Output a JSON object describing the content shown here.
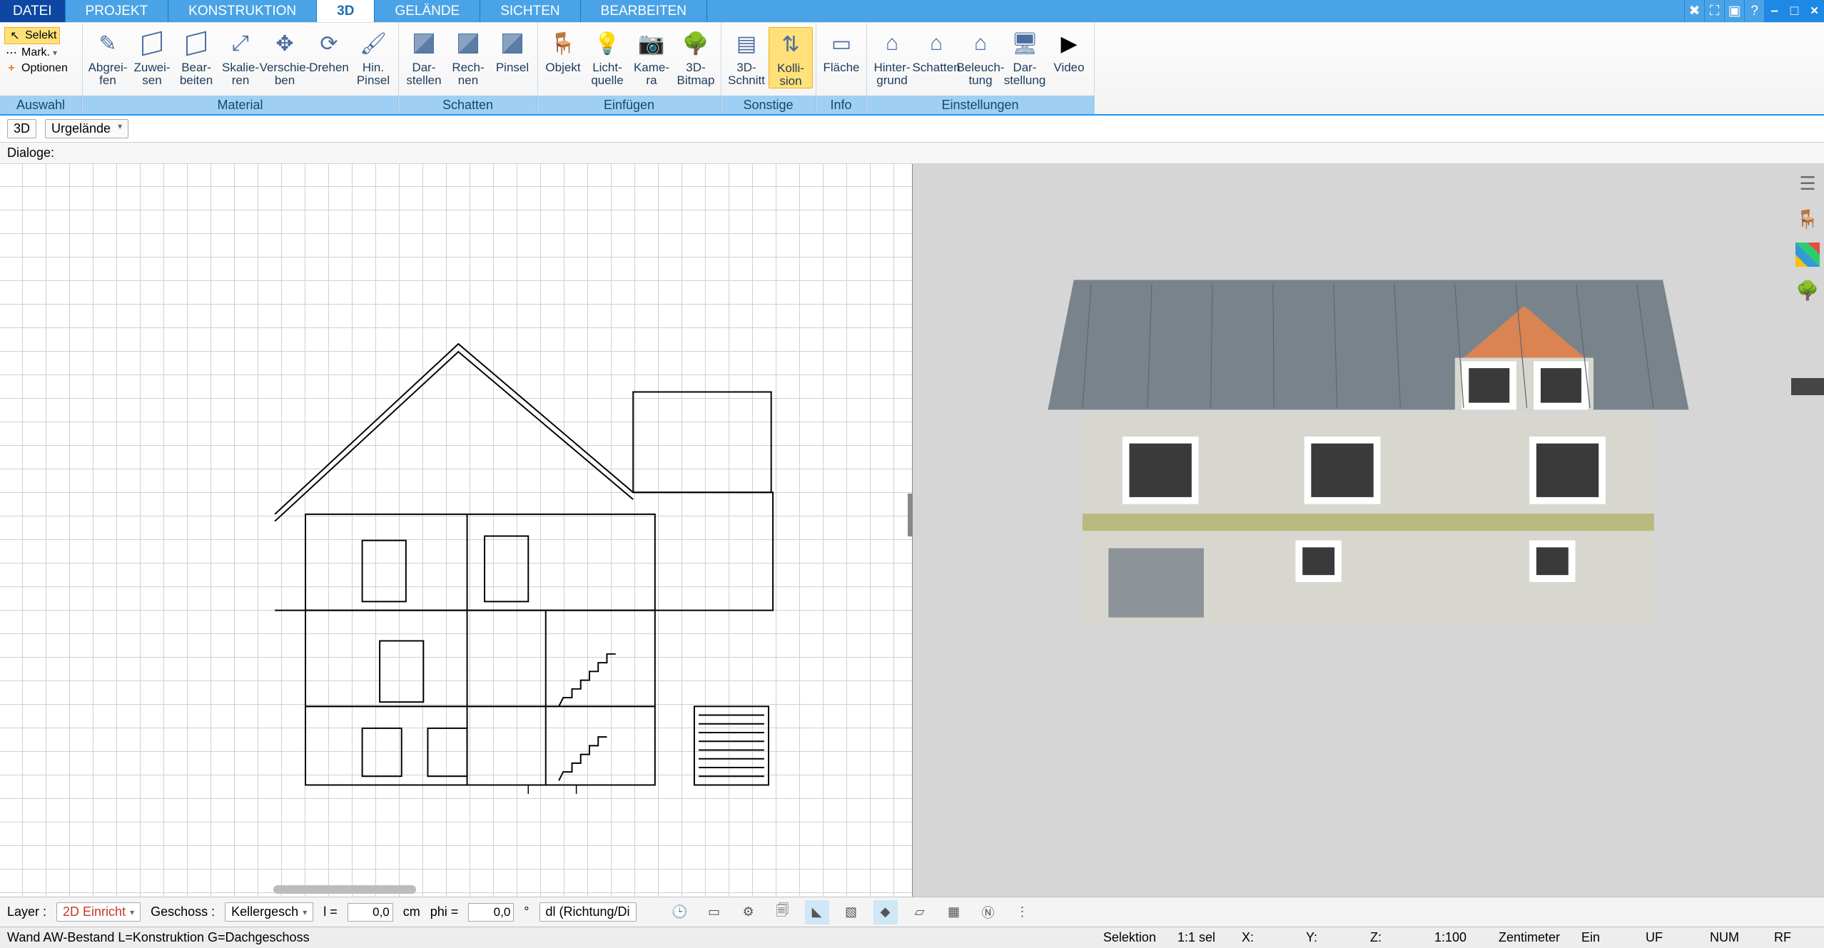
{
  "menu": {
    "tabs": [
      "DATEI",
      "PROJEKT",
      "KONSTRUKTION",
      "3D",
      "GELÄNDE",
      "SICHTEN",
      "BEARBEITEN"
    ],
    "active_index": 3,
    "right_icons": [
      "tools-icon",
      "fullscreen-icon",
      "viewport-icon",
      "help-icon",
      "minimize-icon",
      "maximize-icon",
      "close-icon"
    ]
  },
  "ribbon": {
    "auswahl": {
      "label": "Auswahl",
      "items": [
        "Selekt",
        "Mark.",
        "Optionen"
      ]
    },
    "material": {
      "label": "Material",
      "items": [
        {
          "l": "Abgrei-\nfen",
          "i": "eyedropper-icon"
        },
        {
          "l": "Zuwei-\nsen",
          "i": "assign-icon"
        },
        {
          "l": "Bear-\nbeiten",
          "i": "edit-material-icon"
        },
        {
          "l": "Skalie-\nren",
          "i": "scale-icon"
        },
        {
          "l": "Verschie-\nben",
          "i": "move-material-icon"
        },
        {
          "l": "Drehen",
          "i": "rotate-material-icon"
        },
        {
          "l": "Hin.\nPinsel",
          "i": "brush-add-icon"
        }
      ]
    },
    "schatten": {
      "label": "Schatten",
      "items": [
        {
          "l": "Dar-\nstellen",
          "i": "render-shadow-icon"
        },
        {
          "l": "Rech-\nnen",
          "i": "compute-shadow-icon"
        },
        {
          "l": "Pinsel",
          "i": "shadow-brush-icon"
        }
      ]
    },
    "einfuegen": {
      "label": "Einfügen",
      "items": [
        {
          "l": "Objekt",
          "i": "insert-object-icon"
        },
        {
          "l": "Licht-\nquelle",
          "i": "light-icon"
        },
        {
          "l": "Kame-\nra",
          "i": "camera-icon"
        },
        {
          "l": "3D-\nBitmap",
          "i": "tree-icon"
        }
      ]
    },
    "sonstige": {
      "label": "Sonstige",
      "items": [
        {
          "l": "3D-\nSchnitt",
          "i": "section-3d-icon"
        },
        {
          "l": "Kolli-\nsion",
          "i": "collision-icon",
          "active": true
        }
      ]
    },
    "info": {
      "label": "Info",
      "items": [
        {
          "l": "Fläche",
          "i": "area-icon"
        }
      ]
    },
    "einstellungen": {
      "label": "Einstellungen",
      "items": [
        {
          "l": "Hinter-\ngrund",
          "i": "background-icon"
        },
        {
          "l": "Schatten",
          "i": "shadow-settings-icon"
        },
        {
          "l": "Beleuch-\ntung",
          "i": "lighting-icon"
        },
        {
          "l": "Dar-\nstellung",
          "i": "display-icon"
        },
        {
          "l": "Video",
          "i": "video-icon"
        }
      ]
    }
  },
  "sub1": {
    "view_label": "3D",
    "combo_value": "Urgelände"
  },
  "sub2": {
    "dialoge_label": "Dialoge:"
  },
  "bottom1": {
    "layer_label": "Layer :",
    "layer_value": "2D Einricht",
    "geschoss_label": "Geschoss :",
    "geschoss_value": "Kellergesch",
    "l_label": "l =",
    "l_value": "0,0",
    "cm_label": "cm",
    "phi_label": "phi =",
    "phi_value": "0,0",
    "deg_label": "°",
    "dl_label": "dl (Richtung/Di"
  },
  "bottom2": {
    "status_text": "Wand AW-Bestand L=Konstruktion G=Dachgeschoss",
    "selektion": "Selektion",
    "sel_val": "1:1 sel",
    "x": "X:",
    "y": "Y:",
    "z": "Z:",
    "scale": "1:100",
    "unit": "Zentimeter",
    "ein": "Ein",
    "uf": "UF",
    "num": "NUM",
    "rf": "RF"
  },
  "right_dock": [
    "layers-icon",
    "furniture-icon",
    "color-palette-icon",
    "plant-icon"
  ]
}
